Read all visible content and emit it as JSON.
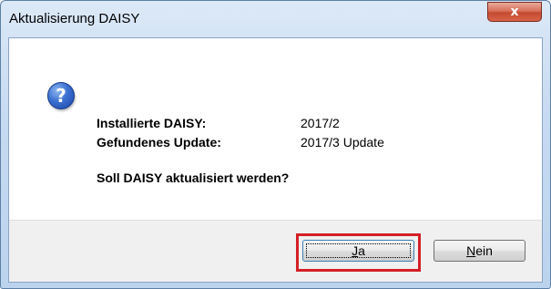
{
  "window": {
    "title": "Aktualisierung DAISY",
    "close_glyph": "x"
  },
  "icon": {
    "name": "question-icon",
    "glyph": "?"
  },
  "info": {
    "installed_label": "Installierte DAISY:",
    "installed_value": "2017/2",
    "found_label": "Gefundenes Update:",
    "found_value": "2017/3 Update"
  },
  "question": "Soll DAISY aktualisiert werden?",
  "buttons": {
    "yes_mnemonic": "J",
    "yes_rest": "a",
    "no_mnemonic": "N",
    "no_rest": "ein"
  },
  "colors": {
    "highlight": "#d41f26",
    "title_bar": "#c6daf1",
    "footer": "#f0f0f0"
  }
}
